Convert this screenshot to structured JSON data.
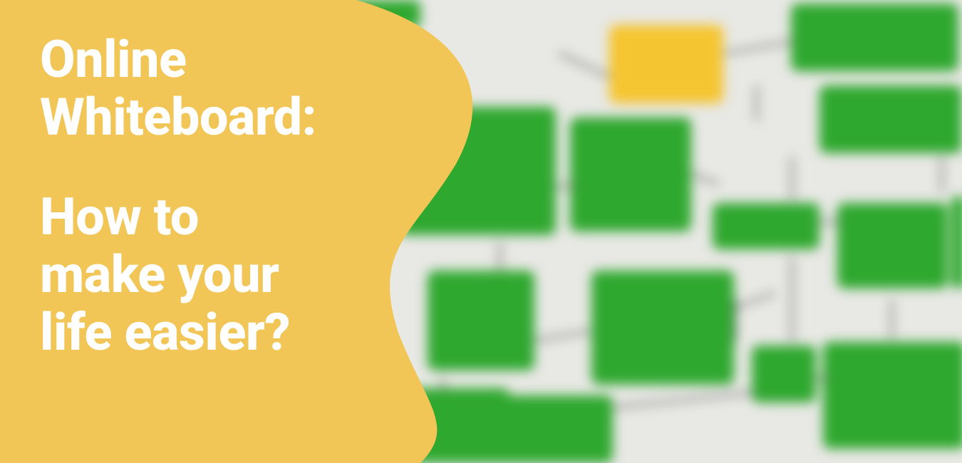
{
  "colors": {
    "accent": "#f1c657",
    "text": "#ffffff",
    "nodeGreen": "#2fa82f",
    "nodeYellow": "#f5c531",
    "canvas": "#e8e8e4"
  },
  "headline": {
    "title_line1": "Online",
    "title_line2": "Whiteboard:",
    "sub_line1": "How to",
    "sub_line2": "make your",
    "sub_line3": "life easier?"
  }
}
